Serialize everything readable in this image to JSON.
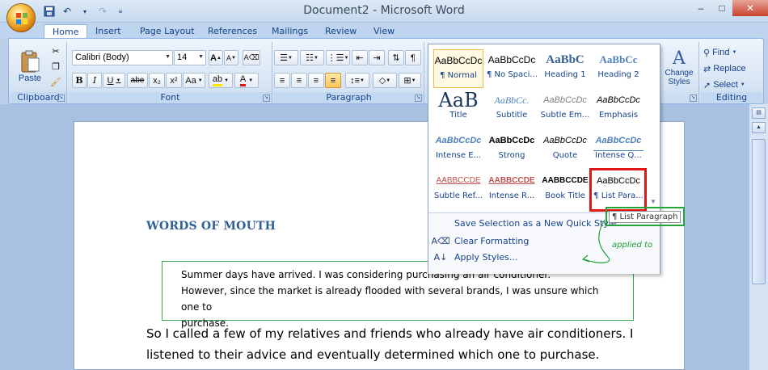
{
  "window": {
    "title": "Document2 - Microsoft Word",
    "minimize": "–",
    "maximize": "□",
    "close": "✕"
  },
  "qat": {
    "save_icon": "save-icon",
    "undo_icon": "undo-icon",
    "redo_icon": "redo-icon",
    "customize_icon": "chevron-down-icon"
  },
  "tabs": [
    {
      "label": "Home",
      "active": true
    },
    {
      "label": "Insert"
    },
    {
      "label": "Page Layout"
    },
    {
      "label": "References"
    },
    {
      "label": "Mailings"
    },
    {
      "label": "Review"
    },
    {
      "label": "View"
    }
  ],
  "ribbon": {
    "clipboard": {
      "label": "Clipboard",
      "paste": "Paste"
    },
    "font": {
      "label": "Font",
      "font_name": "Calibri (Body)",
      "font_size": "14",
      "bold": "B",
      "italic": "I",
      "underline": "U",
      "strike": "abe",
      "subscript": "x₂",
      "superscript": "x²",
      "change_case": "Aa",
      "grow": "A",
      "shrink": "A"
    },
    "paragraph": {
      "label": "Paragraph"
    },
    "styles": {
      "change_styles": "Change Styles"
    },
    "editing": {
      "label": "Editing",
      "find": "Find",
      "replace": "Replace",
      "select": "Select"
    }
  },
  "gallery": {
    "styles": [
      {
        "preview": "AaBbCcDc",
        "name": "¶ Normal",
        "style": "normal"
      },
      {
        "preview": "AaBbCcDc",
        "name": "¶ No Spaci...",
        "style": "nospacing"
      },
      {
        "preview": "AaBbC",
        "name": "Heading 1",
        "style": "h1"
      },
      {
        "preview": "AaBbCc",
        "name": "Heading 2",
        "style": "h2"
      },
      {
        "preview": "AaB",
        "name": "Title",
        "style": "title"
      },
      {
        "preview": "AaBbCc.",
        "name": "Subtitle",
        "style": "subtitle"
      },
      {
        "preview": "AaBbCcDc",
        "name": "Subtle Em...",
        "style": "subtleem"
      },
      {
        "preview": "AaBbCcDc",
        "name": "Emphasis",
        "style": "emphasis"
      },
      {
        "preview": "AaBbCcDc",
        "name": "Intense E...",
        "style": "intenseem"
      },
      {
        "preview": "AaBbCcDc",
        "name": "Strong",
        "style": "strong"
      },
      {
        "preview": "AaBbCcDc",
        "name": "Quote",
        "style": "quote"
      },
      {
        "preview": "AaBbCcDc",
        "name": "Intense Q...",
        "style": "intenseq"
      },
      {
        "preview": "AABBCCDE",
        "name": "Subtle Ref...",
        "style": "subtleref"
      },
      {
        "preview": "AABBCCDE",
        "name": "Intense R...",
        "style": "intenseref"
      },
      {
        "preview": "AABBCCDE",
        "name": "Book Title",
        "style": "booktitle"
      },
      {
        "preview": "AaBbCcDc",
        "name": "¶ List Para...",
        "style": "listpara"
      }
    ],
    "menu": [
      {
        "label": "Save Selection as a New Quick Style...",
        "icon": "save-style-icon"
      },
      {
        "label": "Clear Formatting",
        "icon": "clear-format-icon"
      },
      {
        "label": "Apply Styles...",
        "icon": "apply-styles-icon"
      }
    ],
    "tooltip": "¶ List Paragraph"
  },
  "annotation": {
    "applied_to": "applied to"
  },
  "document": {
    "heading": "WORDS OF MOUTH",
    "list_paragraph": [
      "Summer days have arrived. I was considering purchasing an air conditioner.",
      "However, since the market is already flooded with several brands, I was unsure which one to",
      "purchase."
    ],
    "body": [
      "So I called a few of my relatives and friends who already have air conditioners. I",
      "listened to their advice and eventually determined which one to purchase."
    ]
  },
  "colors": {
    "highlight_red": "#e01616",
    "highlight_green": "#23a33a",
    "heading_blue": "#2f5f96"
  }
}
